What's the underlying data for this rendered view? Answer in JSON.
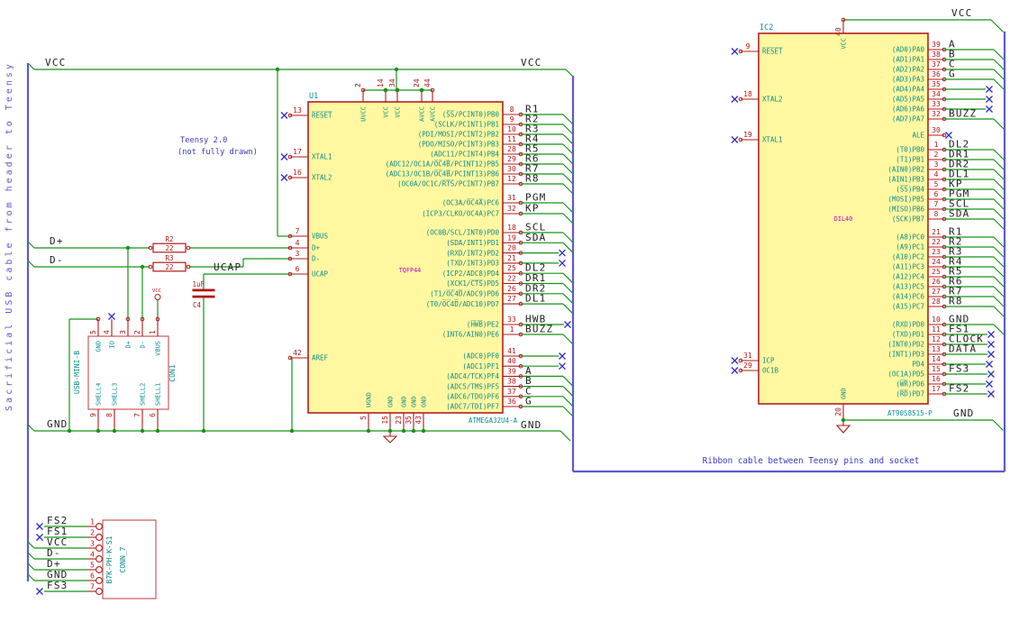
{
  "colors": {
    "wire": "#149414",
    "bus": "#5B5BCE",
    "pin": "#B01818",
    "pin_name": "#0E8C8C",
    "net_label": "#202020",
    "note": "#3A3AC8",
    "side_note": "#6C4FD4",
    "body_fill": "#FFF8A0",
    "body_border": "#B22020",
    "conn_border": "#CC6666",
    "nc": "#2E2EC8",
    "field": "#C800C8"
  },
  "power_labels": {
    "vcc_left": "VCC",
    "vcc_mid": "VCC",
    "vcc_right": "VCC",
    "gnd_left": "GND",
    "gnd_mid": "GND",
    "gnd_right": "GND"
  },
  "net_labels": {
    "d_plus": "D+",
    "d_minus": "D-",
    "ucap": "UCAP"
  },
  "notes": {
    "teensy_line1": "Teensy 2.0",
    "teensy_line2": "(not fully drawn)",
    "ribbon": "Ribbon cable between Teensy pins and socket",
    "sacrificial": "Sacrificial USB cable from header to Teensy"
  },
  "u1": {
    "ref": "U1",
    "value": "ATMEGA32U4-A",
    "footprint": "TQFP44",
    "left_pins": [
      {
        "num": "13",
        "name": "R̅E̅S̅E̅T̅",
        "nc": true
      },
      {
        "num": "17",
        "name": "XTAL1",
        "nc": true
      },
      {
        "num": "16",
        "name": "XTAL2",
        "nc": true
      },
      {
        "num": "7",
        "name": "VBUS"
      },
      {
        "num": "4",
        "name": "D+"
      },
      {
        "num": "3",
        "name": "D-"
      },
      {
        "num": "6",
        "name": "UCAP"
      },
      {
        "num": "42",
        "name": "AREF"
      }
    ],
    "top_pins": [
      {
        "num": "2",
        "name": "UVCC"
      },
      {
        "num": "14",
        "name": "VCC"
      },
      {
        "num": "34",
        "name": "VCC"
      },
      {
        "num": "24",
        "name": "AVCC"
      },
      {
        "num": "44",
        "name": "AVCC"
      }
    ],
    "bottom_pins": [
      {
        "num": "5",
        "name": "UGND"
      },
      {
        "num": "15",
        "name": "GND"
      },
      {
        "num": "23",
        "name": "GND"
      },
      {
        "num": "35",
        "name": "GND"
      },
      {
        "num": "43",
        "name": "GND"
      }
    ],
    "right_groups": [
      {
        "pins": [
          {
            "num": "8",
            "name": "(S̅S̅/PCINT0)PB0",
            "label": "R1"
          },
          {
            "num": "9",
            "name": "(SCLK/PCINT1)PB1",
            "label": "R2"
          },
          {
            "num": "10",
            "name": "(PDI/MOSI/PCINT2)PB2",
            "label": "R3"
          },
          {
            "num": "11",
            "name": "(PDO/MISO/PCINT3)PB3",
            "label": "R4"
          },
          {
            "num": "28",
            "name": "(ADC11/PCINT4)PB4",
            "label": "R5"
          },
          {
            "num": "29",
            "name": "(ADC12/OC1A/O̅C̅4̅B̅/PCINT12)PB5",
            "label": "R6"
          },
          {
            "num": "30",
            "name": "(ADC13/OC1B/O̅C̅4̅B̅/PCINT13)PB6",
            "label": "R7"
          },
          {
            "num": "12",
            "name": "(OC0A/OC1C/R̅T̅S̅/PCINT7)PB7",
            "label": "R8"
          }
        ]
      },
      {
        "pins": [
          {
            "num": "31",
            "name": "(OC3A/O̅C̅4̅A̅)PC6",
            "label": "PGM"
          },
          {
            "num": "32",
            "name": "(ICP3/CLKO/OC4A)PC7",
            "label": "KP"
          }
        ]
      },
      {
        "pins": [
          {
            "num": "18",
            "name": "(OC0B/SCL/INT0)PD0",
            "label": "SCL"
          },
          {
            "num": "19",
            "name": "(SDA/INT1)PD1",
            "label": "SDA"
          },
          {
            "num": "20",
            "name": "(RXD/INT2)PD2",
            "nc": true
          },
          {
            "num": "21",
            "name": "(TXD/INT3)PD3",
            "nc": true
          },
          {
            "num": "25",
            "name": "(ICP2/ADC8)PD4",
            "label": "DL2"
          },
          {
            "num": "22",
            "name": "(XCK1/C̅T̅S̅)PD5",
            "label": "DR1"
          },
          {
            "num": "26",
            "name": "(T1/O̅C̅4̅D̅/ADC9)PD6",
            "label": "DR2"
          },
          {
            "num": "27",
            "name": "(T0/O̅C̅4̅D̅/ADC10)PD7",
            "label": "DL1"
          }
        ]
      },
      {
        "pins": [
          {
            "num": "33",
            "name": "(H̅W̅B̅)PE2",
            "label": "HWB",
            "nc": true
          },
          {
            "num": "1",
            "name": "(INT6/AIN0)PE6",
            "label": "BUZZ"
          }
        ]
      },
      {
        "pins": [
          {
            "num": "41",
            "name": "(ADC0)PF0",
            "nc": true
          },
          {
            "num": "40",
            "name": "(ADC1)PF1",
            "nc": true
          },
          {
            "num": "39",
            "name": "(ADC4/TCK)PF4",
            "label": "A"
          },
          {
            "num": "38",
            "name": "(ADC5/TMS)PF5",
            "label": "B"
          },
          {
            "num": "37",
            "name": "(ADC6/TDO)PF6",
            "label": "C"
          },
          {
            "num": "36",
            "name": "(ADC7/TDI)PF7",
            "label": "G"
          }
        ]
      }
    ]
  },
  "ic2": {
    "ref": "IC2",
    "value": "AT90S8515-P",
    "footprint": "DIL40",
    "left_pins": [
      {
        "num": "9",
        "name": "R̅E̅S̅E̅T̅",
        "nc": true
      },
      {
        "num": "18",
        "name": "XTAL2",
        "nc": true
      },
      {
        "num": "19",
        "name": "XTAL1",
        "nc": true
      },
      {
        "num": "31",
        "name": "ICP",
        "nc": true
      },
      {
        "num": "29",
        "name": "OC1B",
        "nc": true
      }
    ],
    "top_pins": [
      {
        "num": "40",
        "name": "VCC"
      }
    ],
    "bottom_pins": [
      {
        "num": "20",
        "name": "GND"
      }
    ],
    "right_groups": [
      {
        "pins": [
          {
            "num": "39",
            "name": "(AD0)PA0",
            "label": "A"
          },
          {
            "num": "38",
            "name": "(AD1)PA1",
            "label": "B"
          },
          {
            "num": "37",
            "name": "(AD2)PA2",
            "label": "C"
          },
          {
            "num": "36",
            "name": "(AD3)PA3",
            "label": "G"
          },
          {
            "num": "35",
            "name": "(AD4)PA4",
            "nc": true
          },
          {
            "num": "34",
            "name": "(AD5)PA5",
            "nc": true
          },
          {
            "num": "33",
            "name": "(AD6)PA6",
            "nc": true
          },
          {
            "num": "32",
            "name": "(AD7)PA7",
            "label": "BUZZ"
          }
        ]
      },
      {
        "pins": [
          {
            "num": "30",
            "name": "ALE",
            "nc_at_pin": true
          }
        ]
      },
      {
        "pins": [
          {
            "num": "1",
            "name": "(T0)PB0",
            "label": "DL2"
          },
          {
            "num": "2",
            "name": "(T1)PB1",
            "label": "DR1"
          },
          {
            "num": "3",
            "name": "(AIN0)PB2",
            "label": "DR2"
          },
          {
            "num": "4",
            "name": "(AIN1)PB3",
            "label": "DL1"
          },
          {
            "num": "5",
            "name": "(S̅S̅)PB4",
            "label": "KP"
          },
          {
            "num": "6",
            "name": "(MOSI)PB5",
            "label": "PGM"
          },
          {
            "num": "7",
            "name": "(MISO)PB6",
            "label": "SCL"
          },
          {
            "num": "8",
            "name": "(SCK)PB7",
            "label": "SDA"
          }
        ]
      },
      {
        "pins": [
          {
            "num": "21",
            "name": "(A8)PC0",
            "label": "R1"
          },
          {
            "num": "22",
            "name": "(A9)PC1",
            "label": "R2"
          },
          {
            "num": "23",
            "name": "(A10)PC2",
            "label": "R3"
          },
          {
            "num": "24",
            "name": "(A11)PC3",
            "label": "R4"
          },
          {
            "num": "25",
            "name": "(A12)PC4",
            "label": "R5"
          },
          {
            "num": "26",
            "name": "(A13)PC5",
            "label": "R6"
          },
          {
            "num": "27",
            "name": "(A14)PC6",
            "label": "R7"
          },
          {
            "num": "28",
            "name": "(A15)PC7",
            "label": "R8"
          }
        ]
      },
      {
        "pins": [
          {
            "num": "10",
            "name": "(RXD)PD0",
            "label": "GND"
          },
          {
            "num": "11",
            "name": "(TXD)PD1",
            "label": "FS1",
            "nc": true
          },
          {
            "num": "12",
            "name": "(INT0)PD2",
            "label": "CLOCK",
            "nc": true
          },
          {
            "num": "13",
            "name": "(INT1)PD3",
            "label": "DATA",
            "nc": true
          },
          {
            "num": "14",
            "name": "PD4",
            "nc": true
          },
          {
            "num": "15",
            "name": "(OC1A)PD5",
            "label": "FS3",
            "nc": true
          },
          {
            "num": "16",
            "name": "(W̅R̅)PD6",
            "nc": true
          },
          {
            "num": "17",
            "name": "(R̅D̅)PD7",
            "label": "FS2",
            "nc": true
          }
        ]
      }
    ]
  },
  "usb": {
    "ref": "CON1",
    "value": "USB-MINI-B",
    "top_pins": [
      {
        "num": "5",
        "name": "GND"
      },
      {
        "num": "4",
        "name": "ID",
        "nc": true
      },
      {
        "num": "3",
        "name": "D+"
      },
      {
        "num": "2",
        "name": "D-"
      },
      {
        "num": "1",
        "name": "VBUS"
      }
    ],
    "bottom_pins": [
      {
        "num": "9",
        "name": "SHELL4"
      },
      {
        "num": "8",
        "name": "SHELL3"
      },
      {
        "num": "7",
        "name": "SHELL2"
      },
      {
        "num": "6",
        "name": "SHELL1"
      }
    ]
  },
  "conn7": {
    "ref": "CONN_7",
    "value": "B7K-PH-K-S1",
    "rows": [
      {
        "num": "1",
        "label": "FS2",
        "nc": true
      },
      {
        "num": "2",
        "label": "FS1",
        "nc": true
      },
      {
        "num": "3",
        "label": "VCC"
      },
      {
        "num": "4",
        "label": "D-"
      },
      {
        "num": "5",
        "label": "D+"
      },
      {
        "num": "6",
        "label": "GND"
      },
      {
        "num": "7",
        "label": "FS3",
        "nc": true
      }
    ]
  },
  "r2": {
    "ref": "R2",
    "value": "22"
  },
  "r3": {
    "ref": "R3",
    "value": "22"
  },
  "c4": {
    "ref": "C4",
    "value": "1uF"
  },
  "vcc_flag": {
    "label": "VCC"
  }
}
